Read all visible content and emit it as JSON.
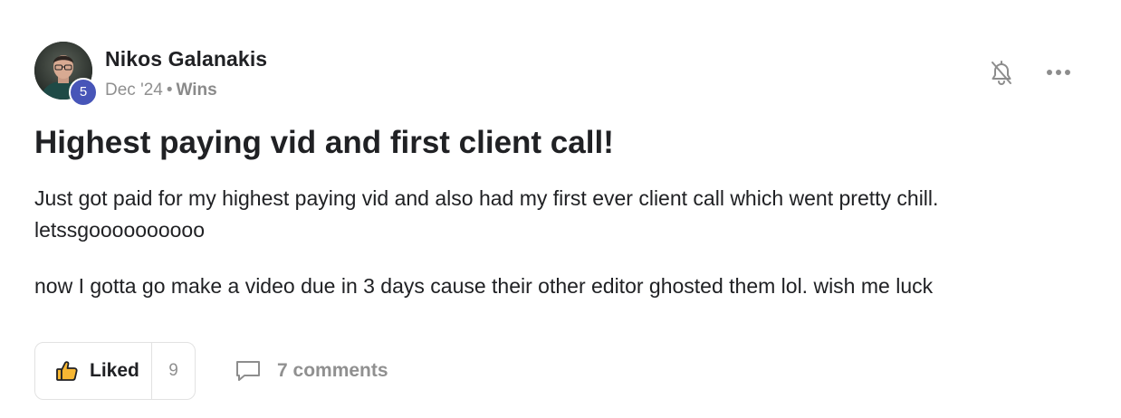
{
  "post": {
    "author": {
      "name": "Nikos Galanakis",
      "level": "5",
      "level_badge_color": "#4755b8"
    },
    "meta": {
      "date": "Dec '24",
      "separator": "•",
      "category": "Wins"
    },
    "actions_top": {
      "notify_icon": "bell-off-icon",
      "more_icon": "more-horizontal-icon"
    },
    "title": "Highest paying vid and first client call!",
    "body": {
      "paragraph_1_line_1": "Just got paid for my highest paying vid and also had my first ever client call which went pretty chill.",
      "paragraph_1_line_2": "letssgoooooooooo",
      "paragraph_2": "now I gotta go make a video due in 3 days cause their other editor ghosted them lol. wish me luck"
    },
    "footer": {
      "like_label": "Liked",
      "like_count": "9",
      "like_icon": "thumbs-up-icon",
      "comments_label": "7 comments",
      "comments_icon": "comment-icon"
    }
  }
}
